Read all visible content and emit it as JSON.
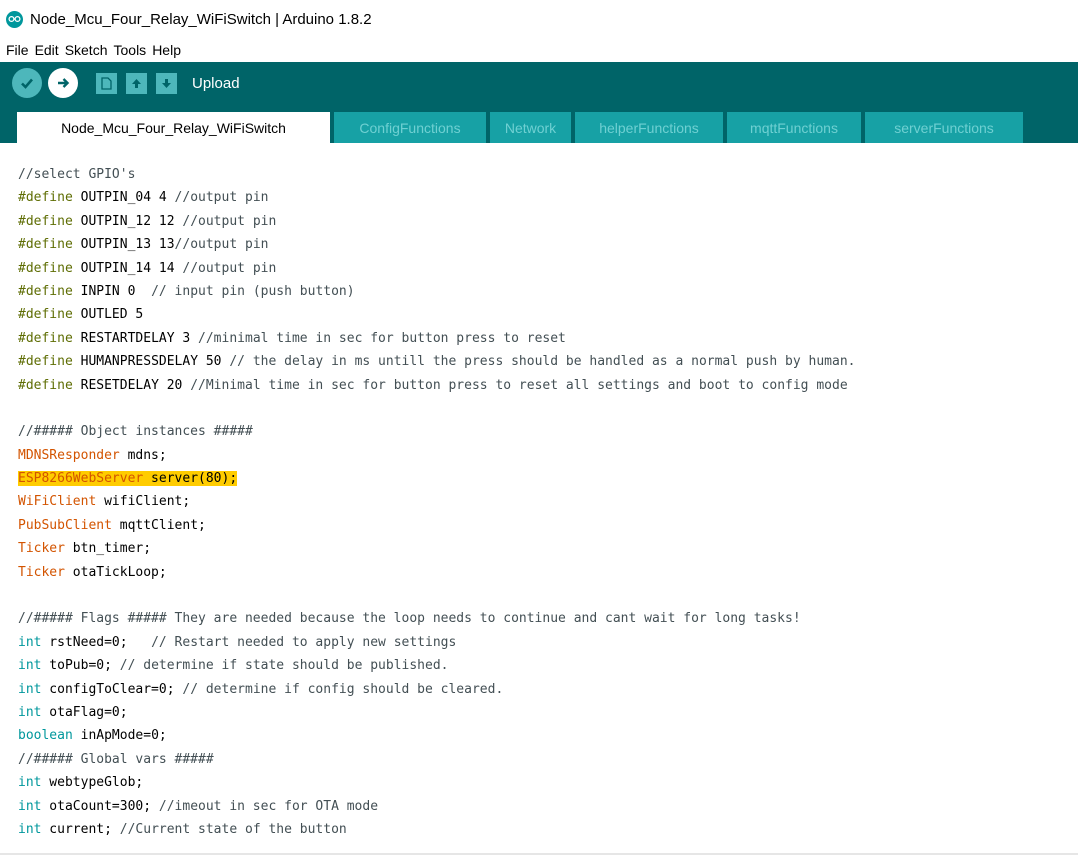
{
  "window": {
    "title": "Node_Mcu_Four_Relay_WiFiSwitch | Arduino 1.8.2"
  },
  "menu": [
    "File",
    "Edit",
    "Sketch",
    "Tools",
    "Help"
  ],
  "toolbar": {
    "status": "Upload",
    "buttons": [
      "verify-icon",
      "upload-icon",
      "new-icon",
      "open-icon",
      "save-icon"
    ]
  },
  "tabs": [
    "Node_Mcu_Four_Relay_WiFiSwitch",
    "ConfigFunctions",
    "Network",
    "helperFunctions",
    "mqttFunctions",
    "serverFunctions"
  ],
  "colors": {
    "accent": "#006468",
    "tab_inactive": "#17a1a5",
    "preprocessor": "#5e6d03",
    "type": "#d35400",
    "keyword": "#00979c",
    "comment": "#434f54",
    "highlight": "#ffcc00"
  },
  "code": [
    [
      {
        "t": "//select GPIO's",
        "c": "c-cm"
      }
    ],
    [
      {
        "t": "#define",
        "c": "c-pp"
      },
      {
        "t": " OUTPIN_04 4 "
      },
      {
        "t": "//output pin",
        "c": "c-cm"
      }
    ],
    [
      {
        "t": "#define",
        "c": "c-pp"
      },
      {
        "t": " OUTPIN_12 12 "
      },
      {
        "t": "//output pin",
        "c": "c-cm"
      }
    ],
    [
      {
        "t": "#define",
        "c": "c-pp"
      },
      {
        "t": " OUTPIN_13 13"
      },
      {
        "t": "//output pin",
        "c": "c-cm"
      }
    ],
    [
      {
        "t": "#define",
        "c": "c-pp"
      },
      {
        "t": " OUTPIN_14 14 "
      },
      {
        "t": "//output pin",
        "c": "c-cm"
      }
    ],
    [
      {
        "t": "#define",
        "c": "c-pp"
      },
      {
        "t": " INPIN 0  "
      },
      {
        "t": "// input pin (push button)",
        "c": "c-cm"
      }
    ],
    [
      {
        "t": "#define",
        "c": "c-pp"
      },
      {
        "t": " OUTLED 5"
      }
    ],
    [
      {
        "t": "#define",
        "c": "c-pp"
      },
      {
        "t": " RESTARTDELAY 3 "
      },
      {
        "t": "//minimal time in sec for button press to reset",
        "c": "c-cm"
      }
    ],
    [
      {
        "t": "#define",
        "c": "c-pp"
      },
      {
        "t": " HUMANPRESSDELAY 50 "
      },
      {
        "t": "// the delay in ms untill the press should be handled as a normal push by human.",
        "c": "c-cm"
      }
    ],
    [
      {
        "t": "#define",
        "c": "c-pp"
      },
      {
        "t": " RESETDELAY 20 "
      },
      {
        "t": "//Minimal time in sec for button press to reset all settings and boot to config mode",
        "c": "c-cm"
      }
    ],
    [],
    [
      {
        "t": "//##### Object instances #####",
        "c": "c-cm"
      }
    ],
    [
      {
        "t": "MDNSResponder",
        "c": "c-type"
      },
      {
        "t": " mdns;"
      }
    ],
    [
      {
        "t": "ESP8266WebServer",
        "c": "c-type hl"
      },
      {
        "t": " server(80);",
        "c": "hl"
      }
    ],
    [
      {
        "t": "WiFiClient",
        "c": "c-type"
      },
      {
        "t": " wifiClient;"
      }
    ],
    [
      {
        "t": "PubSubClient",
        "c": "c-type"
      },
      {
        "t": " mqttClient;"
      }
    ],
    [
      {
        "t": "Ticker",
        "c": "c-type"
      },
      {
        "t": " btn_timer;"
      }
    ],
    [
      {
        "t": "Ticker",
        "c": "c-type"
      },
      {
        "t": " otaTickLoop;"
      }
    ],
    [],
    [
      {
        "t": "//##### Flags ##### They are needed because the loop needs to continue and cant wait for long tasks!",
        "c": "c-cm"
      }
    ],
    [
      {
        "t": "int",
        "c": "c-int"
      },
      {
        "t": " rstNeed=0;   "
      },
      {
        "t": "// Restart needed to apply new settings",
        "c": "c-cm"
      }
    ],
    [
      {
        "t": "int",
        "c": "c-int"
      },
      {
        "t": " toPub=0; "
      },
      {
        "t": "// determine if state should be published.",
        "c": "c-cm"
      }
    ],
    [
      {
        "t": "int",
        "c": "c-int"
      },
      {
        "t": " configToClear=0; "
      },
      {
        "t": "// determine if config should be cleared.",
        "c": "c-cm"
      }
    ],
    [
      {
        "t": "int",
        "c": "c-int"
      },
      {
        "t": " otaFlag=0;"
      }
    ],
    [
      {
        "t": "boolean",
        "c": "c-int"
      },
      {
        "t": " inApMode=0;"
      }
    ],
    [
      {
        "t": "//##### Global vars #####",
        "c": "c-cm"
      }
    ],
    [
      {
        "t": "int",
        "c": "c-int"
      },
      {
        "t": " webtypeGlob;"
      }
    ],
    [
      {
        "t": "int",
        "c": "c-int"
      },
      {
        "t": " otaCount=300; "
      },
      {
        "t": "//imeout in sec for OTA mode",
        "c": "c-cm"
      }
    ],
    [
      {
        "t": "int",
        "c": "c-int"
      },
      {
        "t": " current; "
      },
      {
        "t": "//Current state of the button",
        "c": "c-cm"
      }
    ]
  ]
}
